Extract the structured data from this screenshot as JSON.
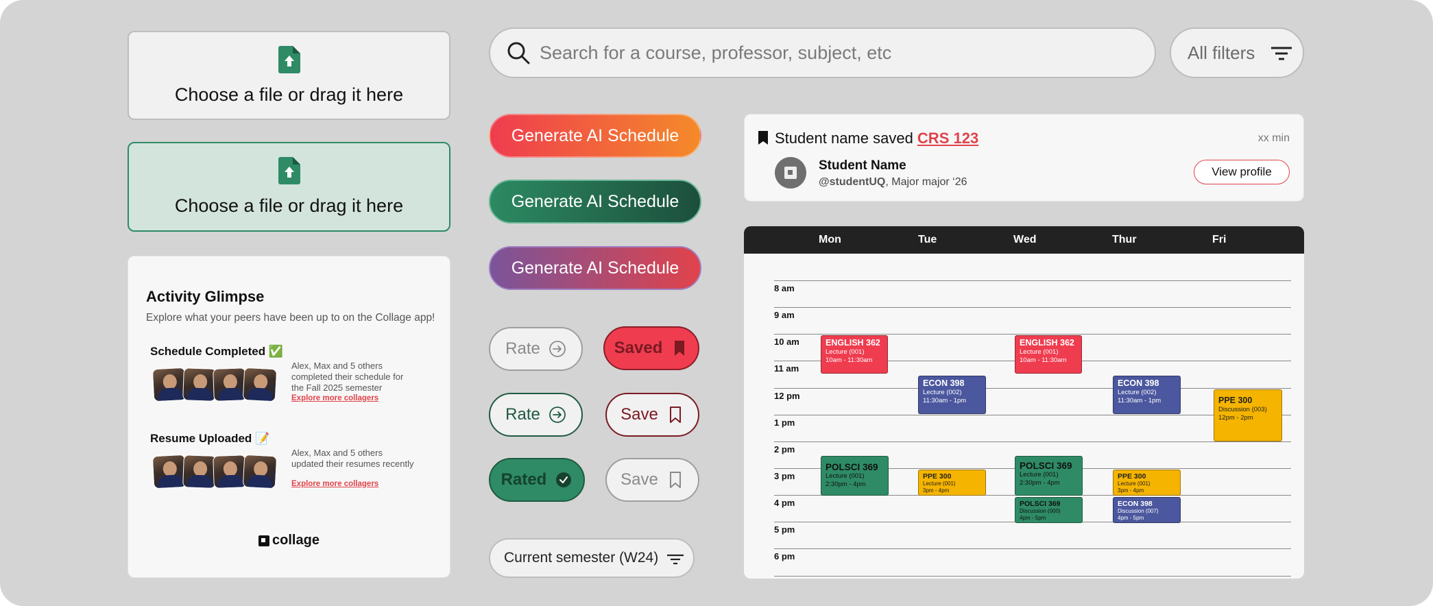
{
  "upload": {
    "label": "Choose a file or drag it here"
  },
  "search": {
    "placeholder": "Search for a course, professor, subject, etc"
  },
  "filters": {
    "label": "All filters"
  },
  "generate": {
    "label": "Generate AI Schedule"
  },
  "rating": {
    "rate": "Rate",
    "rated": "Rated",
    "save": "Save",
    "saved": "Saved"
  },
  "semester": {
    "label": "Current semester (W24)"
  },
  "activity": {
    "title": "Activity Glimpse",
    "subtitle": "Explore what your peers have been up to on the Collage app!",
    "items": [
      {
        "title": "Schedule Completed ✅",
        "desc": "Alex, Max and 5 others completed their schedule for the Fall 2025 semester",
        "link": "Explore more collagers"
      },
      {
        "title": "Resume Uploaded 📝",
        "desc": "Alex, Max and 5 others updated their resumes recently",
        "link": "Explore more collagers"
      }
    ],
    "brand": "collage"
  },
  "notification": {
    "text": "Student name saved ",
    "course": "CRS 123",
    "time": "xx min",
    "name": "Student Name",
    "handle": "@studentUQ",
    "meta": ", Major major ‘26",
    "button": "View profile"
  },
  "calendar": {
    "days": [
      "Mon",
      "Tue",
      "Wed",
      "Thur",
      "Fri"
    ],
    "hours": [
      "8 am",
      "9 am",
      "10 am",
      "11 am",
      "12 pm",
      "1 pm",
      "2 pm",
      "3 pm",
      "4 pm",
      "5 pm",
      "6 pm"
    ],
    "events": [
      {
        "title": "ENGLISH 362",
        "sub": "Lecture (001)",
        "time": "10am - 11:30am",
        "color": "#ef3c4f"
      },
      {
        "title": "ENGLISH 362",
        "sub": "Lecture (001)",
        "time": "10am - 11:30am",
        "color": "#ef3c4f"
      },
      {
        "title": "ECON 398",
        "sub": "Lecture (002)",
        "time": "11:30am - 1pm",
        "color": "#4b579e"
      },
      {
        "title": "ECON 398",
        "sub": "Lecture (002)",
        "time": "11:30am - 1pm",
        "color": "#4b579e"
      },
      {
        "title": "PPE 300",
        "sub": "Discussion (003)",
        "time": "12pm - 2pm",
        "color": "#f5b400"
      },
      {
        "title": "POLSCI 369",
        "sub": "Lecture (001)",
        "time": "2:30pm - 4pm",
        "color": "#2e8b66"
      },
      {
        "title": "POLSCI 369",
        "sub": "Lecture (001)",
        "time": "2:30pm - 4pm",
        "color": "#2e8b66"
      },
      {
        "title": "PPE 300",
        "sub": "Lecture (001)",
        "time": "3pm - 4pm",
        "color": "#f5b400"
      },
      {
        "title": "PPE 300",
        "sub": "Lecture (001)",
        "time": "3pm - 4pm",
        "color": "#f5b400"
      },
      {
        "title": "POLSCI 369",
        "sub": "Discussion (000)",
        "time": "4pm - 5pm",
        "color": "#2e8b66"
      },
      {
        "title": "ECON 398",
        "sub": "Discussion (007)",
        "time": "4pm - 5pm",
        "color": "#4b579e"
      }
    ]
  }
}
